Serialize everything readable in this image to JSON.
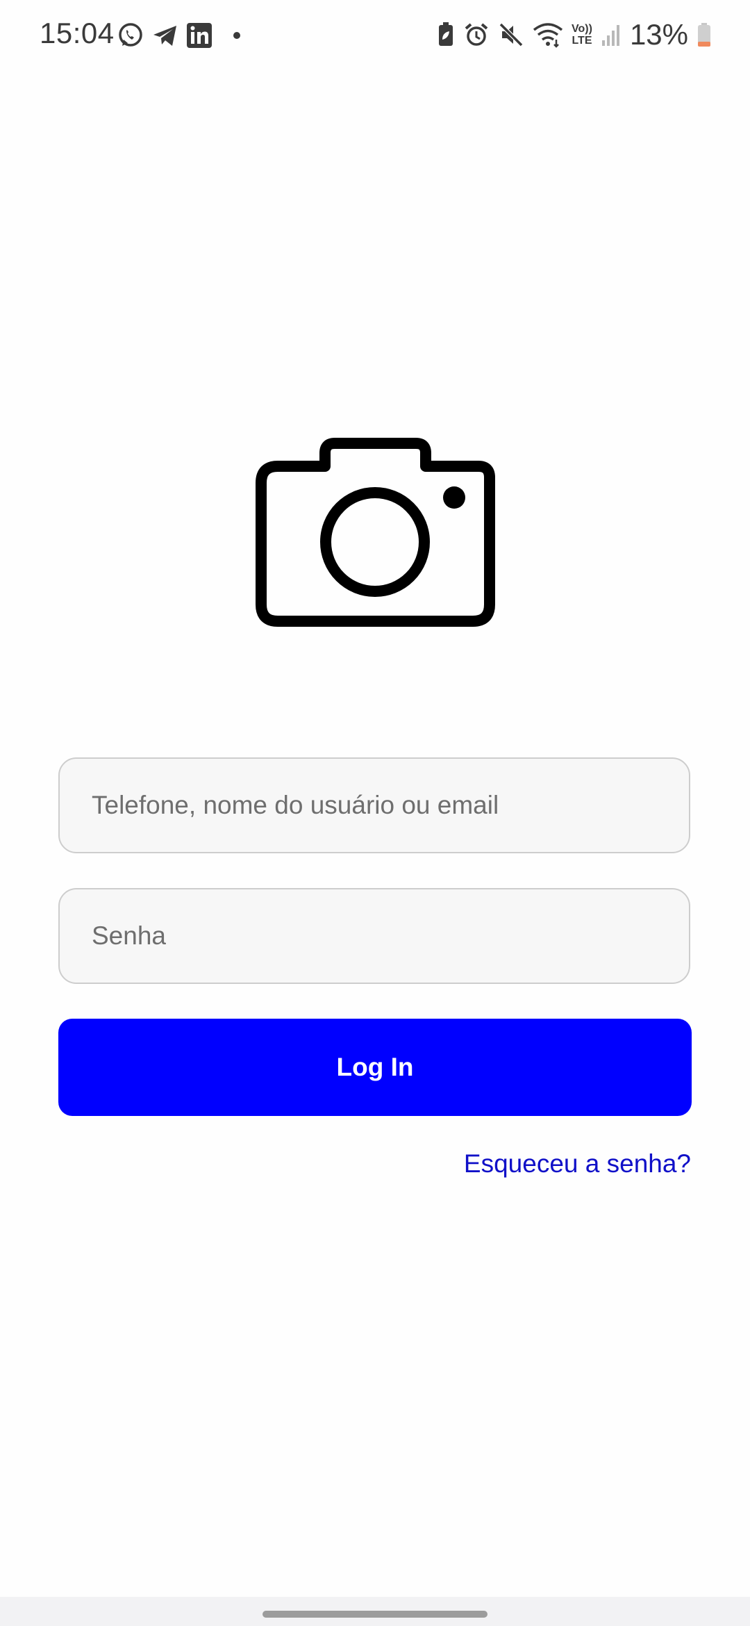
{
  "status_bar": {
    "time": "15:04",
    "battery_percent": "13%",
    "left_icons": [
      "whatsapp-icon",
      "telegram-icon",
      "linkedin-icon",
      "notification-dot"
    ],
    "right_icons": [
      "battery-saver-icon",
      "alarm-icon",
      "mute-icon",
      "wifi-icon",
      "volte-icon",
      "signal-icon",
      "battery-icon"
    ],
    "volte_label_top": "Vo))",
    "volte_label_bottom": "LTE"
  },
  "login": {
    "logo_icon": "camera-icon",
    "username_placeholder": "Telefone, nome do usuário ou email",
    "password_placeholder": "Senha",
    "login_button": "Log In",
    "forgot_password": "Esqueceu a senha?"
  },
  "colors": {
    "primary_button": "#0000ff",
    "link": "#1010c8",
    "input_background": "#f7f7f7",
    "input_border": "#cdcdcd"
  }
}
